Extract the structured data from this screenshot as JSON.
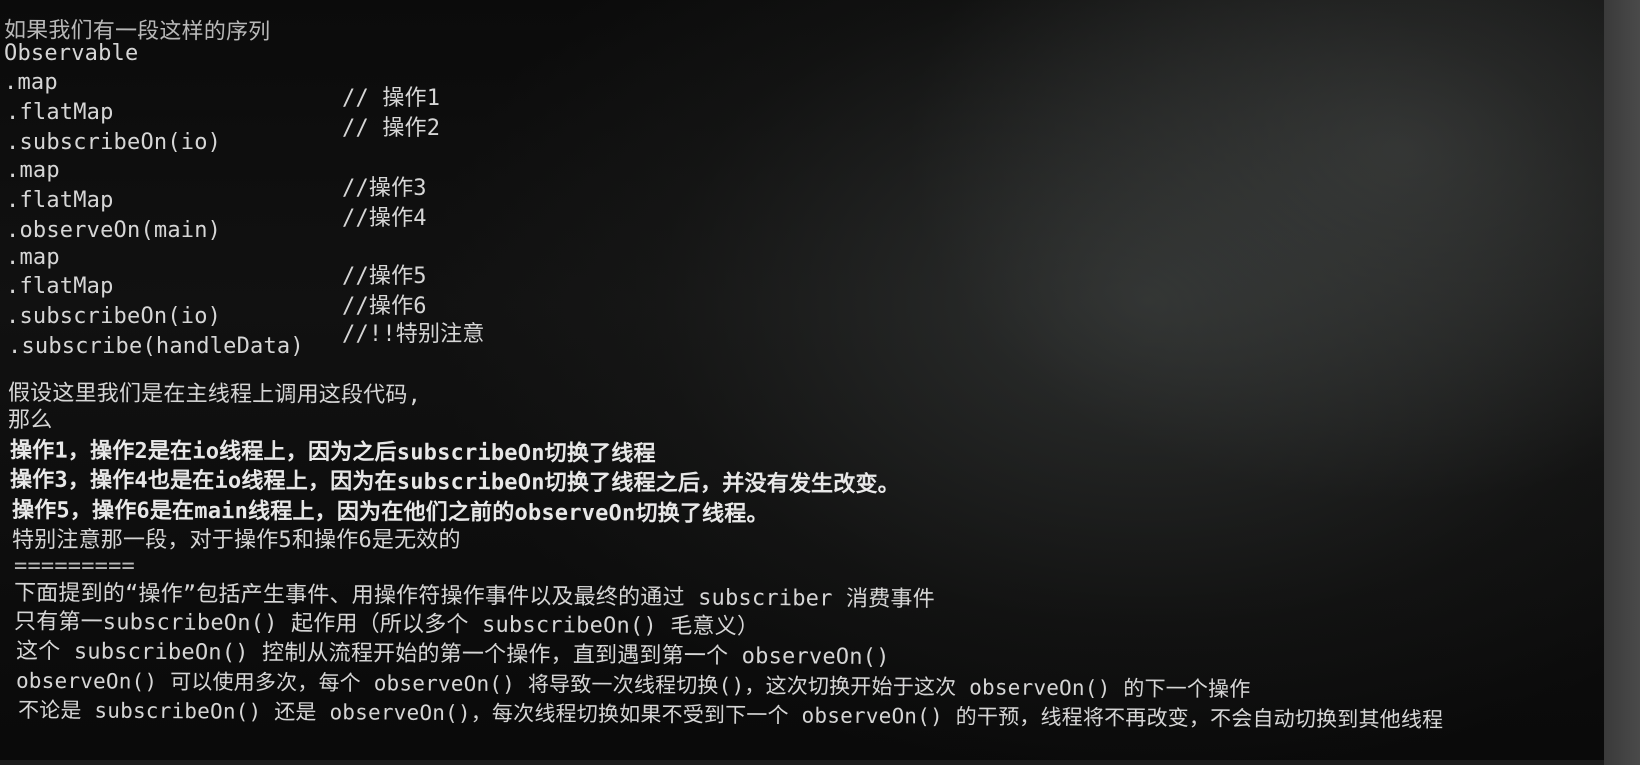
{
  "intro": "如果我们有一段这样的序列",
  "code": {
    "obs": "Observable",
    "map1": ".map",
    "flat1": ".flatMap",
    "sub1": ".subscribeOn(io)",
    "map2": ".map",
    "flat2": ".flatMap",
    "obsOn": ".observeOn(main)",
    "map3": ".map",
    "flat3": ".flatMap",
    "sub2": ".subscribeOn(io)",
    "subscribe": ".subscribe(handleData)"
  },
  "comments": {
    "c1": "// 操作1",
    "c2": "// 操作2",
    "c3": "//操作3",
    "c4": "//操作4",
    "c5": "//操作5",
    "c6": "//操作6",
    "c7": "//!!特别注意"
  },
  "explain": {
    "l1": "假设这里我们是在主线程上调用这段代码,",
    "l2": "那么",
    "l3": "操作1，操作2是在io线程上，因为之后subscribeOn切换了线程",
    "l4": "操作3，操作4也是在io线程上，因为在subscribeOn切换了线程之后，并没有发生改变。",
    "l5": "操作5，操作6是在main线程上，因为在他们之前的observeOn切换了线程。",
    "l6": "特别注意那一段，对于操作5和操作6是无效的"
  },
  "separator": "=========",
  "rules": {
    "r1": "下面提到的“操作”包括产生事件、用操作符操作事件以及最终的通过 subscriber 消费事件",
    "r2": "只有第一subscribeOn() 起作用（所以多个 subscribeOn() 毛意义）",
    "r3": "这个 subscribeOn() 控制从流程开始的第一个操作，直到遇到第一个 observeOn()",
    "r4": "observeOn() 可以使用多次，每个 observeOn() 将导致一次线程切换()，这次切换开始于这次 observeOn() 的下一个操作",
    "r5": "不论是 subscribeOn() 还是 observeOn()，每次线程切换如果不受到下一个 observeOn() 的干预，线程将不再改变，不会自动切换到其他线程"
  }
}
